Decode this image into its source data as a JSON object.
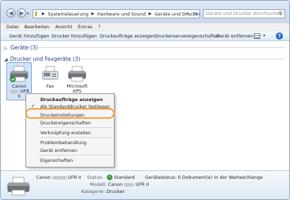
{
  "address": {
    "crumbs": [
      "Systemsteuerung",
      "Hardware und Sound",
      "Geräte und Drucker"
    ],
    "search_placeholder": "Geräte und Drucker durchsuchen"
  },
  "menu": [
    "Datei",
    "Bearbeiten",
    "Ansicht",
    "Extras",
    "?"
  ],
  "toolbar": {
    "add_device": "Gerät hinzufügen",
    "add_printer": "Drucker hinzufügen",
    "print_jobs": "Druckaufträge anzeigen",
    "server_props": "Druckerservereigenschaften",
    "remove_device": "Gerät entfernen"
  },
  "groups": {
    "devices": "Geräte (3)",
    "printers": "Drucker und Faxgeräte (3)"
  },
  "printers": [
    {
      "line1": "Canon",
      "line2": "UFR",
      "line3": "II"
    },
    {
      "line1": "Fax"
    },
    {
      "line1": "Microsoft",
      "line2": "XPS"
    }
  ],
  "context_menu": {
    "print_jobs": "Druckaufträge anzeigen",
    "set_default": "Als Standarddrucker festlegen",
    "preferences": "Druckeinstellungen",
    "properties": "Druckereigenschaften",
    "create_shortcut": "Verknüpfung erstellen",
    "troubleshoot": "Problembehandlung",
    "remove": "Gerät entfernen",
    "device_props": "Eigenschaften"
  },
  "details": {
    "name_a": "Canon",
    "name_b": "UFR II",
    "status_key": "Status:",
    "status_val": "Standard",
    "model_key": "Modell:",
    "model_a": "Canon",
    "model_b": "UFR II",
    "category_key": "Kategorie:",
    "category_val": "Drucker",
    "device_status": "Gerätestatus: 0 Dokument(e) in der Warteschlange"
  },
  "colors": {
    "highlight_ring": "#f0a030",
    "group_title": "#1e3a8a",
    "selection": "#cfe3fb"
  }
}
